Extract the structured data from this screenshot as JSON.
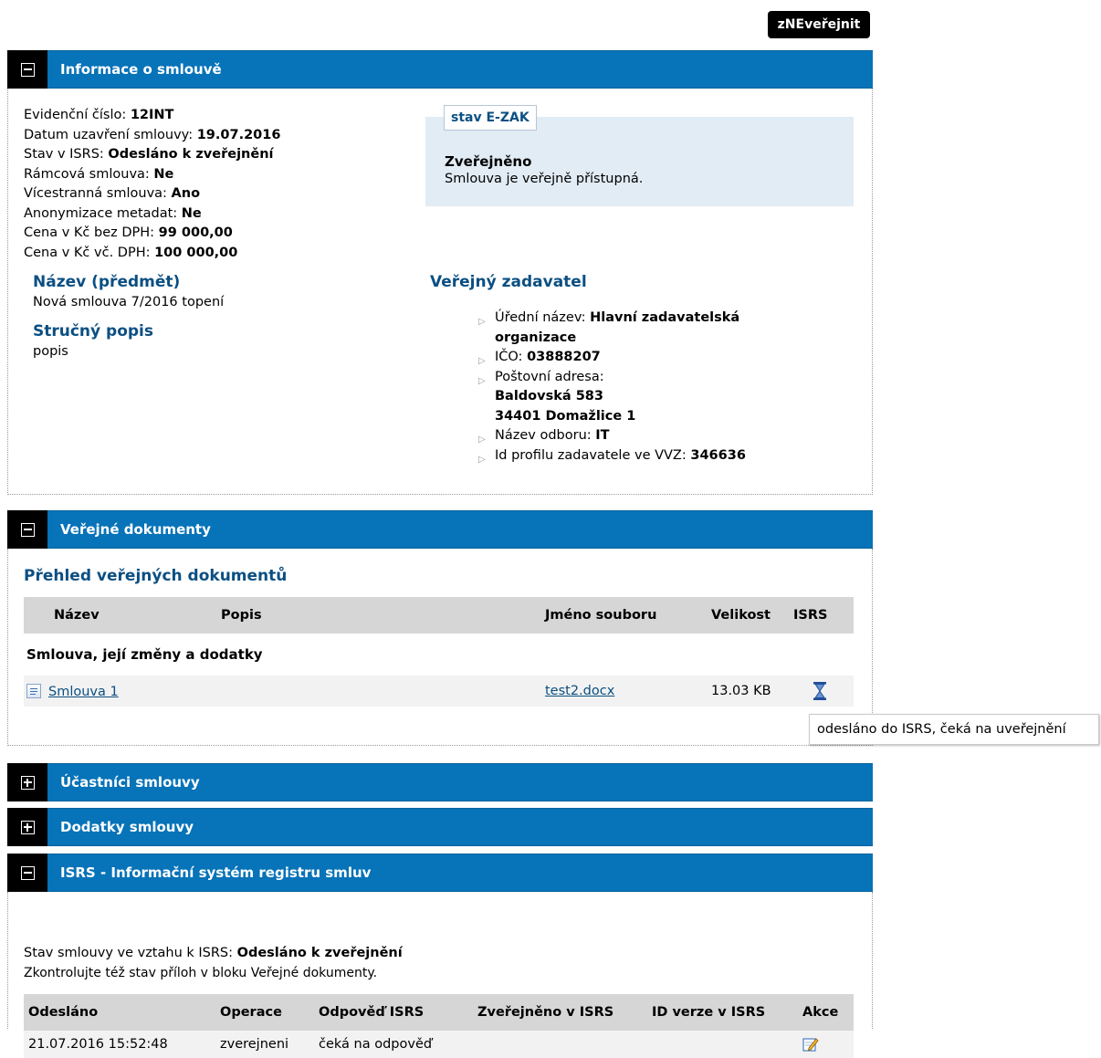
{
  "top_button": "zNEveřejnit",
  "info": {
    "title": "Informace o smlouvě",
    "fields": [
      {
        "label": "Evidenční číslo: ",
        "value": "12INT"
      },
      {
        "label": "Datum uzavření smlouvy: ",
        "value": "19.07.2016"
      },
      {
        "label": "Stav v ISRS: ",
        "value": "Odesláno k zveřejnění"
      },
      {
        "label": "Rámcová smlouva: ",
        "value": "Ne"
      },
      {
        "label": "Vícestranná smlouva: ",
        "value": "Ano"
      },
      {
        "label": "Anonymizace metadat: ",
        "value": "Ne"
      },
      {
        "label": "Cena v Kč bez DPH: ",
        "value": "99 000,00"
      },
      {
        "label": "Cena v Kč vč. DPH: ",
        "value": "100 000,00"
      }
    ],
    "ezak": {
      "tab": "stav E-ZAK",
      "status": "Zveřejněno",
      "desc": "Smlouva je veřejně přístupná."
    },
    "name_heading": "Název (předmět)",
    "name_value": "Nová smlouva 7/2016 topení",
    "desc_heading": "Stručný popis",
    "desc_value": "popis",
    "authority": {
      "heading": "Veřejný zadavatel",
      "official_label": "Úřední název: ",
      "official_value_1": "Hlavní zadavatelská",
      "official_value_2": "organizace",
      "ico_label": "IČO: ",
      "ico_value": "03888207",
      "address_label": "Poštovní adresa:",
      "address_1": "Baldovská 583",
      "address_2": "34401 Domažlice 1",
      "dept_label": "Název odboru: ",
      "dept_value": "IT",
      "profile_label": "Id profilu zadavatele ve VVZ: ",
      "profile_value": "346636"
    }
  },
  "docs": {
    "title": "Veřejné dokumenty",
    "subtitle": "Přehled veřejných dokumentů",
    "headers": [
      "Název",
      "Popis",
      "Jméno souboru",
      "Velikost",
      "ISRS"
    ],
    "group": "Smlouva, její změny a dodatky",
    "row": {
      "name": "Smlouva 1",
      "desc": "",
      "file": "test2.docx",
      "size": "13.03 KB",
      "isrs_icon": "hourglass-icon"
    },
    "tooltip": "odesláno do ISRS, čeká na uveřejnění"
  },
  "participants": {
    "title": "Účastníci smlouvy"
  },
  "amendments": {
    "title": "Dodatky smlouvy"
  },
  "isrs": {
    "title": "ISRS - Informační systém registru smluv",
    "status_label": "Stav smlouvy ve vztahu k ISRS: ",
    "status_value": "Odesláno k zveřejnění",
    "note": "Zkontrolujte též stav příloh v bloku Veřejné dokumenty.",
    "headers": [
      "Odesláno",
      "Operace",
      "Odpověď ISRS",
      "Zveřejněno v ISRS",
      "ID verze v ISRS",
      "Akce"
    ],
    "row": {
      "sent": "21.07.2016 15:52:48",
      "op": "zverejneni",
      "resp": "čeká na odpověď",
      "published": "",
      "version": "",
      "action_icon": "edit-icon"
    }
  },
  "colors": {
    "header_blue": "#0773b8",
    "heading_blue": "#0b4f82",
    "ezak_bg": "#e2ecf5",
    "table_head": "#d6d6d6"
  }
}
